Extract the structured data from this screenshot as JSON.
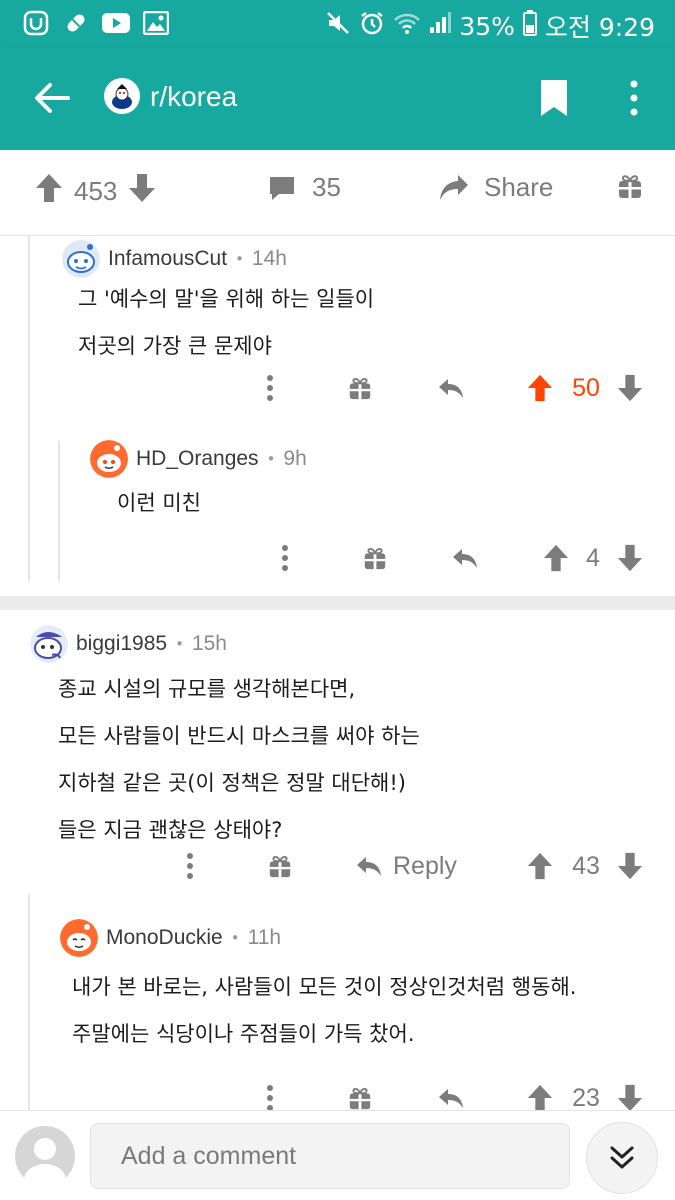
{
  "status_bar": {
    "left_icons": [
      "u-plus-icon",
      "pill-icon",
      "youtube-icon",
      "image-icon"
    ],
    "battery": "35%",
    "time": "오전 9:29"
  },
  "app_bar": {
    "subreddit": "r/korea"
  },
  "post_actions": {
    "score": "453",
    "comment_count": "35",
    "share_label": "Share"
  },
  "comments": [
    {
      "username": "InfamousCut",
      "time": "14h",
      "lines": [
        "그 '예수의 말'을 위해 하는 일들이",
        "저곳의 가장 큰 문제야"
      ],
      "score": "50",
      "upvoted": true
    },
    {
      "username": "HD_Oranges",
      "time": "9h",
      "lines": [
        "이런 미친"
      ],
      "score": "4"
    },
    {
      "username": "biggi1985",
      "time": "15h",
      "lines": [
        "종교 시설의 규모를 생각해본다면,",
        "모든 사람들이 반드시 마스크를 써야 하는",
        "지하철 같은 곳(이 정책은 정말 대단해!)",
        "들은 지금 괜찮은 상태야?"
      ],
      "reply_label": "Reply",
      "score": "43"
    },
    {
      "username": "MonoDuckie",
      "time": "11h",
      "lines": [
        "내가 본 바로는, 사람들이 모든 것이 정상인것처럼 행동해.",
        "주말에는 식당이나 주점들이 가득 찼어."
      ],
      "score": "23"
    }
  ],
  "bottom_bar": {
    "placeholder": "Add a comment"
  },
  "colors": {
    "brand": "#17a99f",
    "upvote": "#ff4500",
    "icon_gray": "#7c7c7c"
  }
}
